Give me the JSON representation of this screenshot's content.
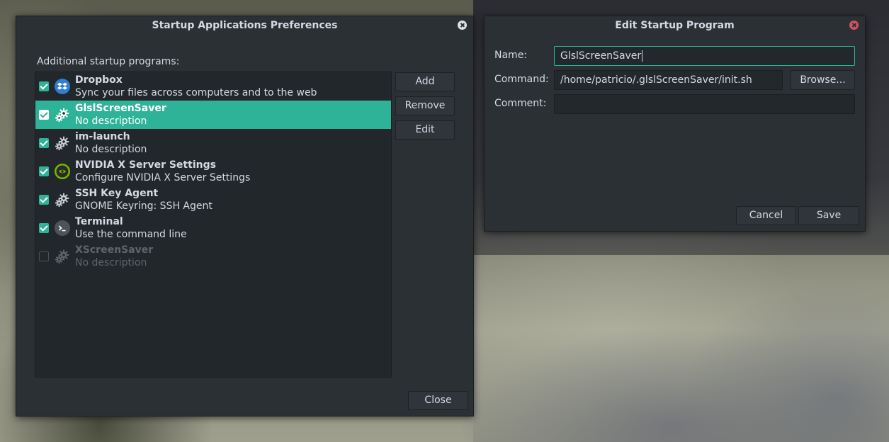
{
  "main_window": {
    "title": "Startup Applications Preferences",
    "section_label": "Additional startup programs:",
    "programs": [
      {
        "name": "Dropbox",
        "description": "Sync your files across computers and to the web",
        "enabled": true,
        "icon": "dropbox-icon",
        "selected": false
      },
      {
        "name": "GlslScreenSaver",
        "description": "No description",
        "enabled": true,
        "icon": "gear-icon",
        "selected": true
      },
      {
        "name": "im-launch",
        "description": "No description",
        "enabled": true,
        "icon": "gear-icon",
        "selected": false
      },
      {
        "name": "NVIDIA X Server Settings",
        "description": "Configure NVIDIA X Server Settings",
        "enabled": true,
        "icon": "nvidia-icon",
        "selected": false
      },
      {
        "name": "SSH Key Agent",
        "description": "GNOME Keyring: SSH Agent",
        "enabled": true,
        "icon": "gear-icon",
        "selected": false
      },
      {
        "name": "Terminal",
        "description": "Use the command line",
        "enabled": true,
        "icon": "terminal-icon",
        "selected": false
      },
      {
        "name": "XScreenSaver",
        "description": "No description",
        "enabled": false,
        "icon": "gear-icon",
        "selected": false
      }
    ],
    "buttons": {
      "add": "Add",
      "remove": "Remove",
      "edit": "Edit",
      "close": "Close"
    }
  },
  "edit_window": {
    "title": "Edit Startup Program",
    "name_label": "Name:",
    "name_value": "GlslScreenSaver",
    "command_label": "Command:",
    "command_value": "/home/patricio/.glslScreenSaver/init.sh",
    "comment_label": "Comment:",
    "comment_value": "",
    "buttons": {
      "browse": "Browse...",
      "cancel": "Cancel",
      "save": "Save"
    }
  },
  "colors": {
    "accent": "#2eb398",
    "window_bg": "#2b3035",
    "list_bg": "#22272b",
    "text": "#d3dae3",
    "close_red": "#cc575d"
  }
}
